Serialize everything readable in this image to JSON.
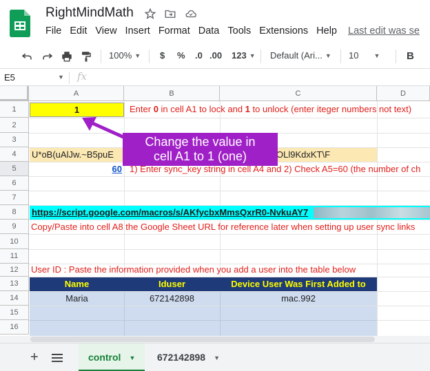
{
  "app": {
    "title": "RightMindMath",
    "menu": [
      "File",
      "Edit",
      "View",
      "Insert",
      "Format",
      "Data",
      "Tools",
      "Extensions",
      "Help"
    ],
    "last_edit": "Last edit was se"
  },
  "toolbar": {
    "zoom": "100%",
    "currency": "$",
    "percent": "%",
    "decrease_decimal": ".0",
    "increase_decimal": ".00",
    "more_formats": "123",
    "font": "Default (Ari...",
    "font_size": "10"
  },
  "formula_bar": {
    "name_box": "E5",
    "fx": "fx"
  },
  "columns": [
    "A",
    "B",
    "C",
    "D"
  ],
  "rows": [
    "1",
    "2",
    "3",
    "4",
    "5",
    "6",
    "7",
    "8",
    "9",
    "10",
    "11",
    "12",
    "13",
    "14",
    "15",
    "16"
  ],
  "cells": {
    "a1": "1",
    "b1_prefix": "Enter ",
    "b1_zero": "0",
    "b1_mid": " in cell A1 to lock and ",
    "b1_one": "1",
    "b1_suffix": " to unlock (enter iteger numbers not text)",
    "a4_left": "U*oB(uAlJw.~B5puE",
    "a4_right": "OLl9KdxKT\\F",
    "a5": "60",
    "b5": "1) Enter sync_key string in cell A4  and  2) Check A5=60 (the number of ch",
    "a8": "https://script.google.com/macros/s/AKfycbxMmsQxrR0-NvkuAY7",
    "a9": "Copy/Paste into cell A8 the Google Sheet URL for reference later when setting up user sync links",
    "a12": "User ID : Paste the information provided when you add a user into the table below",
    "table": {
      "headers": [
        "Name",
        "Iduser",
        "Device User Was First Added to"
      ],
      "rows": [
        [
          "Maria",
          "672142898",
          "mac.992"
        ]
      ]
    }
  },
  "callout": {
    "line1": "Change the value in",
    "line2": "cell A1 to 1 (one)"
  },
  "sheets": {
    "add": "+",
    "tabs": [
      "control",
      "672142898"
    ],
    "active": "control"
  },
  "colors": {
    "yellow": "#ffff00",
    "light_yellow": "#fce8b2",
    "cyan": "#00ffff",
    "header_navy": "#1f3a78",
    "header_text": "#ffff00",
    "table_body": "#cfdcef",
    "annotation": "#a020c8",
    "red_text": "#e0201b"
  }
}
